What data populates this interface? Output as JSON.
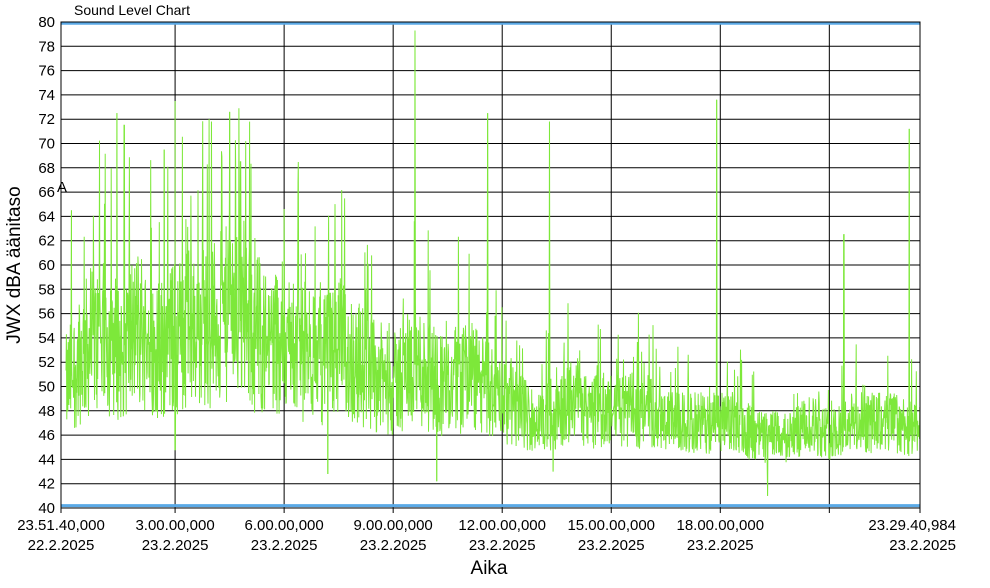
{
  "chart_data": {
    "type": "line",
    "title": "Sound Level Chart",
    "xlabel": "Aika",
    "ylabel": "JWX dBA äänitaso",
    "ylim": [
      40,
      80
    ],
    "yticks": [
      40,
      42,
      44,
      46,
      48,
      50,
      52,
      54,
      56,
      58,
      60,
      62,
      64,
      66,
      68,
      70,
      72,
      74,
      76,
      78,
      80
    ],
    "xlim_hours": [
      -0.1389,
      23.4947
    ],
    "xticks": [
      {
        "time": "23.51.40,000",
        "date": "22.2.2025",
        "h": -0.1389
      },
      {
        "time": "3.00.00,000",
        "date": "23.2.2025",
        "h": 3
      },
      {
        "time": "6.00.00,000",
        "date": "23.2.2025",
        "h": 6
      },
      {
        "time": "9.00.00,000",
        "date": "23.2.2025",
        "h": 9
      },
      {
        "time": "12.00.00,000",
        "date": "23.2.2025",
        "h": 12
      },
      {
        "time": "15.00.00,000",
        "date": "23.2.2025",
        "h": 15
      },
      {
        "time": "18.00.00,000",
        "date": "23.2.2025",
        "h": 18
      },
      {
        "time": "",
        "date": "",
        "h": 21
      },
      {
        "time": "23.29.40,984",
        "date": "23.2.2025",
        "h": 23.4947
      }
    ],
    "grid": true,
    "marker_label": "A",
    "colors": {
      "series": "#7de83a",
      "limit_line": "#5aa9e6",
      "grid": "#000000"
    },
    "limit_lines": [
      40.2,
      79.9
    ],
    "series": [
      {
        "x": [
          0.0,
          0.5,
          1.0,
          1.5,
          2.0,
          2.5,
          3.0,
          3.5,
          4.0,
          4.5,
          5.0,
          5.5,
          6.0,
          6.5,
          7.0,
          7.5,
          8.0,
          8.5,
          9.0,
          9.5,
          10.0,
          10.5,
          11.0,
          11.5,
          12.0,
          12.5,
          13.0,
          13.5,
          14.0,
          14.5,
          15.0,
          15.5,
          16.0,
          16.5,
          17.0,
          17.5,
          18.0,
          18.5,
          19.0,
          19.5,
          20.0,
          20.5,
          21.0,
          21.5,
          22.0,
          22.5,
          23.0,
          23.49
        ],
        "y": [
          50,
          53,
          54,
          53,
          55,
          53,
          54,
          55,
          55,
          56,
          55,
          54,
          54,
          53,
          52,
          53,
          52,
          51,
          50,
          52,
          51,
          50,
          51,
          50,
          49,
          48,
          47,
          48,
          49,
          48,
          48,
          48,
          48,
          47,
          47,
          47,
          47,
          47,
          46,
          46,
          46,
          47,
          46,
          47,
          47,
          47,
          47,
          46
        ],
        "peaks": [
          {
            "h": 0.15,
            "v": 64.5
          },
          {
            "h": 1.4,
            "v": 72.5
          },
          {
            "h": 1.6,
            "v": 71.5
          },
          {
            "h": 2.7,
            "v": 69.5
          },
          {
            "h": 3.0,
            "v": 73.5
          },
          {
            "h": 4.0,
            "v": 71.8
          },
          {
            "h": 4.5,
            "v": 72.6
          },
          {
            "h": 4.8,
            "v": 68.5
          },
          {
            "h": 7.4,
            "v": 65.0
          },
          {
            "h": 9.6,
            "v": 79.3
          },
          {
            "h": 11.6,
            "v": 72.5
          },
          {
            "h": 13.3,
            "v": 71.8
          },
          {
            "h": 17.9,
            "v": 73.6
          },
          {
            "h": 21.4,
            "v": 62.5
          },
          {
            "h": 23.2,
            "v": 71.2
          }
        ],
        "dips": [
          {
            "h": 3.0,
            "v": 44.8
          },
          {
            "h": 7.2,
            "v": 42.8
          },
          {
            "h": 10.2,
            "v": 42.2
          },
          {
            "h": 13.4,
            "v": 43.0
          },
          {
            "h": 19.3,
            "v": 41.0
          }
        ]
      }
    ]
  }
}
